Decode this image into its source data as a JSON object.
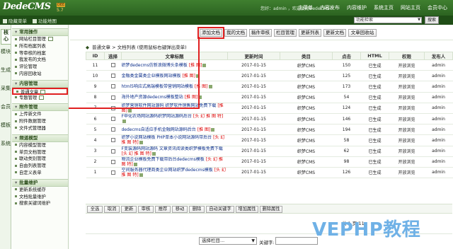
{
  "header": {
    "logo": "DedeCMS",
    "version_badge": "5.7",
    "version_top": "DEE",
    "user_info": "您好：admin ，欢迎使用DedeCMS!",
    "nav": [
      "主菜单",
      "内容发布",
      "内容维护",
      "系统主页",
      "网站主页",
      "会员中心"
    ]
  },
  "subbar": {
    "hide_menu": "隐藏菜单",
    "func_map": "功能地图",
    "func_search_value": "功能检索",
    "search_btn": "搜索"
  },
  "vtabs": [
    "核心",
    "模块",
    "生成",
    "采集",
    "会员",
    "模板",
    "系统"
  ],
  "sidebar": {
    "sections": [
      {
        "title": "常用操作",
        "items": [
          "网站栏目管理",
          "所有档案列表",
          "等审核的档案",
          "我发布的文档",
          "评论管理",
          "内容回收站"
        ]
      },
      {
        "title": "内容管理",
        "items": [
          "普通文章",
          "专题管理"
        ]
      },
      {
        "title": "附件管理",
        "items": [
          "上传新文件",
          "附件数据管理",
          "文件式管理器"
        ]
      },
      {
        "title": "频道模型",
        "items": [
          "内容模型管理",
          "单页文档管理",
          "联动类别管理",
          "自由列表管理",
          "自定义表单"
        ]
      },
      {
        "title": "批量维护",
        "items": [
          "更新系统缓存",
          "文档批量维护",
          "搜索关键词维护"
        ]
      }
    ]
  },
  "toolbar": [
    "添加文档",
    "我的文档",
    "稿件审核",
    "栏目管理",
    "更新列表",
    "更新文档",
    "文章回收站"
  ],
  "breadcrumb": "普通文章 > 文档列表  (使用鼠标右键弹出菜单)",
  "table": {
    "columns": [
      "ID",
      "选择",
      "文章标题",
      "更新时间",
      "类目",
      "点击",
      "HTML",
      "权限",
      "发布人"
    ],
    "rows": [
      {
        "id": "11",
        "title": "织梦dedecms仿新浪微博头条模板",
        "flag": "[推 图]",
        "date": "2017-01-15",
        "cat": "织梦CMS",
        "clicks": "150",
        "html": "已生成",
        "perm": "开放浏览",
        "author": "admin"
      },
      {
        "id": "10",
        "title": "金融类金属类企业模板网站模板",
        "flag": "[推 图]",
        "date": "2017-01-15",
        "cat": "织梦CMS",
        "clicks": "125",
        "html": "已生成",
        "perm": "开放浏览",
        "author": "admin"
      },
      {
        "id": "9",
        "title": "html5响应式高端模板带营销网站模板",
        "flag": "[推 图]",
        "date": "2017-01-15",
        "cat": "织梦CMS",
        "clicks": "173",
        "html": "已生成",
        "perm": "开放浏览",
        "author": "admin"
      },
      {
        "id": "8",
        "title": "海外地产资源dedecms模板整站",
        "flag": "[推 图]",
        "date": "2017-01-15",
        "cat": "织梦CMS",
        "clicks": "54",
        "html": "已生成",
        "perm": "开放浏览",
        "author": "admin"
      },
      {
        "id": "7",
        "title": "织梦营销软件网站源码 织梦软件销售网站免费下载",
        "flag": "[推 图]",
        "date": "2017-01-15",
        "cat": "织梦CMS",
        "clicks": "124",
        "html": "已生成",
        "perm": "开放浏览",
        "author": "admin"
      },
      {
        "id": "6",
        "title": "F申化农场网站源码织梦网站源码后台",
        "flag": "[头 幻 推 图 特]",
        "date": "2017-01-15",
        "cat": "织梦CMS",
        "clicks": "146",
        "html": "已生成",
        "perm": "开放浏览",
        "author": "admin"
      },
      {
        "id": "5",
        "title": "dedecms自适应手机金融网站源码后台",
        "flag": "[推 图]",
        "date": "2017-01-15",
        "cat": "织梦CMS",
        "clicks": "194",
        "html": "已生成",
        "perm": "开放浏览",
        "author": "admin"
      },
      {
        "id": "4",
        "title": "织梦小说网站模板 PHP单本小说网站源码带后台",
        "flag": "[头 幻 推 图 特]",
        "date": "2017-01-15",
        "cat": "织梦CMS",
        "clicks": "58",
        "html": "已生成",
        "perm": "开放浏览",
        "author": "admin"
      },
      {
        "id": "3",
        "title": "F变装源码网站源码 文章资讯阅读类织梦模板免费下载",
        "flag": "[头 幻 推 图 特]",
        "date": "2017-01-15",
        "cat": "织梦CMS",
        "clicks": "62",
        "html": "已生成",
        "perm": "开放浏览",
        "author": "admin"
      },
      {
        "id": "2",
        "title": "物流企业模板免费下载带后台dedecms模板",
        "flag": "[头 幻 推 图 特]",
        "date": "2017-01-15",
        "cat": "织梦CMS",
        "clicks": "98",
        "html": "已生成",
        "perm": "开放浏览",
        "author": "admin"
      },
      {
        "id": "1",
        "title": "空间服务器代理商类企业网站织梦dedecms模板",
        "flag": "[头 幻 推 图 特]",
        "date": "2017-01-15",
        "cat": "织梦CMS",
        "clicks": "126",
        "html": "已生成",
        "perm": "开放浏览",
        "author": "admin"
      }
    ]
  },
  "actions": [
    "全选",
    "取消",
    "更新",
    "审核",
    "推荐",
    "移动",
    "删除",
    "自动关键字",
    "增加属性",
    "删除属性"
  ],
  "pagination": "共 1 页/11",
  "bottom": {
    "select_value": "选择栏目...",
    "keyword_label": "关键字:"
  },
  "watermark": "VEPHP教程"
}
